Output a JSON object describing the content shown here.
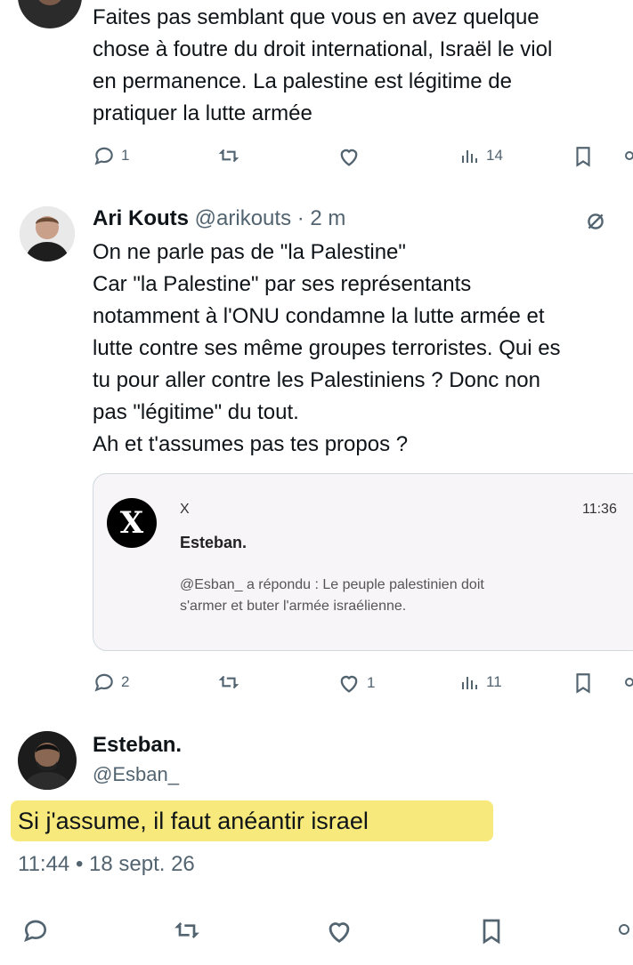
{
  "tweet_top": {
    "lines": [
      "Faites pas semblant que vous en avez quelque",
      "chose à foutre du droit international, Israël le viol",
      "en permanence. La palestine est légitime de",
      "pratiquer la lutte armée"
    ],
    "reply_count": "1",
    "views": "14"
  },
  "tweet_reply": {
    "author_name": "Ari Kouts",
    "author_handle": "@arikouts",
    "time": "· 2 m",
    "lines": [
      "On ne parle pas de \"la Palestine\"",
      "Car \"la Palestine\" par ses représentants",
      "notamment à l'ONU condamne la lutte armée et",
      "lutte contre ses même groupes terroristes. Qui es",
      "tu pour aller contre les Palestiniens ? Donc non",
      "pas \"légitime\" du tout.",
      "Ah et t'assumes pas tes propos ?"
    ],
    "quote": {
      "app": "X",
      "time": "11:36",
      "title": "Esteban.",
      "body_lines": [
        "@Esban_ a répondu : Le peuple palestinien doit",
        "s'armer et buter l'armée israélienne."
      ]
    },
    "reply_count": "2",
    "like_count": "1",
    "views": "11"
  },
  "tweet_main": {
    "author_name": "Esteban.",
    "author_handle": "@Esban_",
    "text": "Si j'assume, il faut anéantir israel",
    "timestamp": "11:44 • 18 sept. 26"
  },
  "colors": {
    "highlight": "#f5e45a",
    "muted": "#536471",
    "text": "#0f1419"
  }
}
